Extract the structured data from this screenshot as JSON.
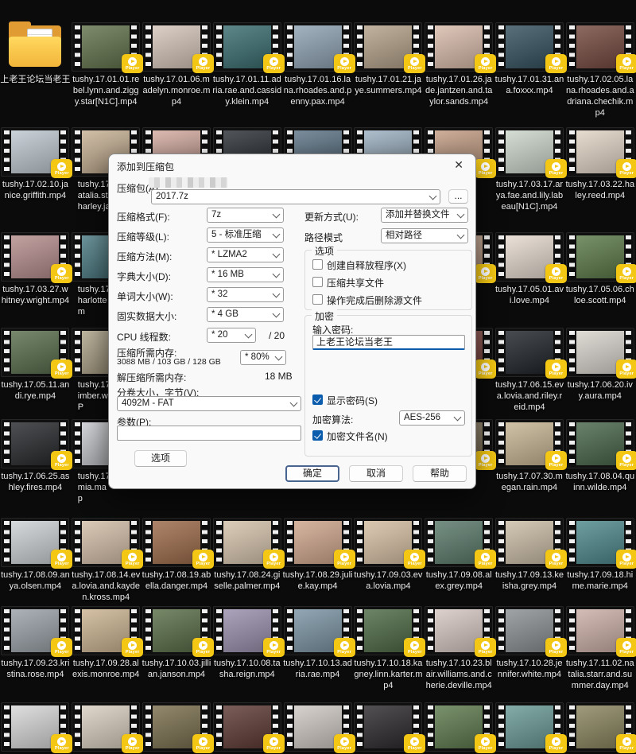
{
  "colors": {
    "accent_blue": "#0b5cad",
    "badge_yellow": "#f3c714",
    "folder_yellow": "#f2b43a"
  },
  "desktop": {
    "player_badge": "Player",
    "rows": [
      {
        "items": [
          {
            "kind": "folder",
            "label": "上老王论坛当老王"
          },
          {
            "kind": "video",
            "label": "tushy.17.01.01.rebel.lynn.and.ziggy.star[N1C].mp4",
            "color": "#62734c"
          },
          {
            "kind": "video",
            "label": "tushy.17.01.06.madelyn.monroe.mp4",
            "color": "#d6c6ba"
          },
          {
            "kind": "video",
            "label": "tushy.17.01.11.adria.rae.and.cassidy.klein.mp4",
            "color": "#3a6d70"
          },
          {
            "kind": "video",
            "label": "tushy.17.01.16.lana.rhoades.and.penny.pax.mp4",
            "color": "#8fa3b3"
          },
          {
            "kind": "video",
            "label": "tushy.17.01.21.jaye.summers.mp4",
            "color": "#b5a28a"
          },
          {
            "kind": "video",
            "label": "tushy.17.01.26.jade.jantzen.and.taylor.sands.mp4",
            "color": "#d9bcab"
          },
          {
            "kind": "video",
            "label": "tushy.17.01.31.ana.foxxx.mp4",
            "color": "#35525f"
          },
          {
            "kind": "video",
            "label": "tushy.17.02.05.lana.rhoades.and.adriana.chechik.mp4",
            "color": "#74493f"
          }
        ]
      },
      {
        "items": [
          {
            "kind": "video",
            "label": "tushy.17.02.10.janice.griffith.mp4",
            "color": "#bfc9d1"
          },
          {
            "kind": "video",
            "label": "tushy.17\natalia.st\nharley.ja",
            "color": "#c7b194",
            "pre": true
          },
          {
            "kind": "video",
            "label": "",
            "color": "#d4aba0"
          },
          {
            "kind": "video",
            "label": "",
            "color": "#2c3137"
          },
          {
            "kind": "video",
            "label": "",
            "color": "#5e7587"
          },
          {
            "kind": "video",
            "label": "",
            "color": "#9db1c2"
          },
          {
            "kind": "video",
            "label": "",
            "color": "#c49e85"
          },
          {
            "kind": "video",
            "label": "tushy.17.03.17.arya.fae.and.lily.labeau[N1C].mp4",
            "color": "#ccd6cc"
          },
          {
            "kind": "video",
            "label": "tushy.17.03.22.haley.reed.mp4",
            "color": "#e2d5c6"
          }
        ]
      },
      {
        "items": [
          {
            "kind": "video",
            "label": "tushy.17.03.27.whitney.wright.mp4",
            "color": "#b68d8d"
          },
          {
            "kind": "video",
            "label": "tushy.17\nharlotte\nm",
            "color": "#4d7e86",
            "pre": true
          },
          {
            "kind": "video",
            "label": "",
            "color": "#3a3a3a"
          },
          {
            "kind": "video",
            "label": "",
            "color": "#3a3a3a"
          },
          {
            "kind": "video",
            "label": "",
            "color": "#3a3a3a"
          },
          {
            "kind": "video",
            "label": "",
            "color": "#3a3a3a"
          },
          {
            "kind": "video",
            "label": "",
            "color": "#c9a78f"
          },
          {
            "kind": "video",
            "label": "tushy.17.05.01.avi.love.mp4",
            "color": "#e6dad0"
          },
          {
            "kind": "video",
            "label": "tushy.17.05.06.chloe.scott.mp4",
            "color": "#5c7a49"
          }
        ]
      },
      {
        "items": [
          {
            "kind": "video",
            "label": "tushy.17.05.11.andi.rye.mp4",
            "color": "#596e4d"
          },
          {
            "kind": "video",
            "label": "tushy.17\nimber.w\nP",
            "color": "#b2a78c",
            "pre": true
          },
          {
            "kind": "video",
            "label": "",
            "color": "#3a3a3a"
          },
          {
            "kind": "video",
            "label": "",
            "color": "#3a3a3a"
          },
          {
            "kind": "video",
            "label": "",
            "color": "#3a3a3a"
          },
          {
            "kind": "video",
            "label": "",
            "color": "#3a3a3a"
          },
          {
            "kind": "video",
            "label": "",
            "color": "#8a4a44"
          },
          {
            "kind": "video",
            "label": "tushy.17.06.15.eva.lovia.and.riley.reid.mp4",
            "color": "#20242a"
          },
          {
            "kind": "video",
            "label": "tushy.17.06.20.ivy.aura.mp4",
            "color": "#d9d4cd"
          }
        ]
      },
      {
        "items": [
          {
            "kind": "video",
            "label": "tushy.17.06.25.ashley.fires.mp4",
            "color": "#27292c"
          },
          {
            "kind": "video",
            "label": "tushy.17\nmia.ma\np",
            "color": "#cdced2",
            "pre": true
          },
          {
            "kind": "video",
            "label": "",
            "color": "#3a3a3a"
          },
          {
            "kind": "video",
            "label": "",
            "color": "#3a3a3a"
          },
          {
            "kind": "video",
            "label": "",
            "color": "#3a3a3a"
          },
          {
            "kind": "video",
            "label": "",
            "color": "#3a3a3a"
          },
          {
            "kind": "video",
            "label": "",
            "color": "#8a7a5e"
          },
          {
            "kind": "video",
            "label": "tushy.17.07.30.megan.rain.mp4",
            "color": "#c8b694"
          },
          {
            "kind": "video",
            "label": "tushy.17.08.04.quinn.wilde.mp4",
            "color": "#49664a"
          }
        ]
      },
      {
        "items": [
          {
            "kind": "video",
            "label": "tushy.17.08.09.anya.olsen.mp4",
            "color": "#ced2d5"
          },
          {
            "kind": "video",
            "label": "tushy.17.08.14.eva.lovia.and.kayden.kross.mp4",
            "color": "#d5bfa9"
          },
          {
            "kind": "video",
            "label": "tushy.17.08.19.abella.danger.mp4",
            "color": "#9e6c4b"
          },
          {
            "kind": "video",
            "label": "tushy.17.08.24.giselle.palmer.mp4",
            "color": "#d8c5ae"
          },
          {
            "kind": "video",
            "label": "tushy.17.08.29.julie.kay.mp4",
            "color": "#d1a88e"
          },
          {
            "kind": "video",
            "label": "tushy.17.09.03.eva.lovia.mp4",
            "color": "#d8c1a5"
          },
          {
            "kind": "video",
            "label": "tushy.17.09.08.alex.grey.mp4",
            "color": "#5b7a6b"
          },
          {
            "kind": "video",
            "label": "tushy.17.09.13.keisha.grey.mp4",
            "color": "#ccbea7"
          },
          {
            "kind": "video",
            "label": "tushy.17.09.18.hime.marie.mp4",
            "color": "#4f898d"
          }
        ]
      },
      {
        "items": [
          {
            "kind": "video",
            "label": "tushy.17.09.23.kristina.rose.mp4",
            "color": "#9ba2a9"
          },
          {
            "kind": "video",
            "label": "tushy.17.09.28.alexis.monroe.mp4",
            "color": "#ccb592"
          },
          {
            "kind": "video",
            "label": "tushy.17.10.03.jillian.janson.mp4",
            "color": "#5a6e48"
          },
          {
            "kind": "video",
            "label": "tushy.17.10.08.tasha.reign.mp4",
            "color": "#9a90ad"
          },
          {
            "kind": "video",
            "label": "tushy.17.10.13.adria.rae.mp4",
            "color": "#7b94a4"
          },
          {
            "kind": "video",
            "label": "tushy.17.10.18.kagney.linn.karter.mp4",
            "color": "#4e6a45"
          },
          {
            "kind": "video",
            "label": "tushy.17.10.23.blair.williams.and.cherie.deville.mp4",
            "color": "#d7c8c3"
          },
          {
            "kind": "video",
            "label": "tushy.17.10.28.jennifer.white.mp4",
            "color": "#8b9093"
          },
          {
            "kind": "video",
            "label": "tushy.17.11.02.natalia.starr.and.summer.day.mp4",
            "color": "#ccafa7"
          }
        ]
      },
      {
        "items": [
          {
            "kind": "video",
            "label": "",
            "color": "#d8d8d8"
          },
          {
            "kind": "video",
            "label": "",
            "color": "#d9cfc0"
          },
          {
            "kind": "video",
            "label": "",
            "color": "#7a6f4e"
          },
          {
            "kind": "video",
            "label": "",
            "color": "#5e3a34"
          },
          {
            "kind": "video",
            "label": "",
            "color": "#cfc9c4"
          },
          {
            "kind": "video",
            "label": "",
            "color": "#2e2a2e"
          },
          {
            "kind": "video",
            "label": "",
            "color": "#5e7a4e"
          },
          {
            "kind": "video",
            "label": "",
            "color": "#6a9a96"
          },
          {
            "kind": "video",
            "label": "",
            "color": "#8a855e"
          }
        ]
      }
    ]
  },
  "dialog": {
    "title": "添加到压缩包",
    "archive_label": "压缩包(A)",
    "archive_name": "2017.7z",
    "browse": "...",
    "fields_left": [
      {
        "label": "压缩格式(F):",
        "value": "7z"
      },
      {
        "label": "压缩等级(L):",
        "value": "5 - 标准压缩"
      },
      {
        "label": "压缩方法(M):",
        "value": "* LZMA2"
      },
      {
        "label": "字典大小(D):",
        "value": "* 16 MB"
      },
      {
        "label": "单词大小(W):",
        "value": "* 32"
      },
      {
        "label": "固实数据大小:",
        "value": "* 4 GB"
      }
    ],
    "cpu": {
      "label": "CPU 线程数:",
      "value": "* 20",
      "suffix": "/ 20"
    },
    "mem_compress": {
      "label": "压缩所需内存:",
      "detail": "3088 MB / 103 GB / 128 GB",
      "value": "* 80%"
    },
    "mem_decompress": {
      "label": "解压缩所需内存:",
      "value": "18 MB"
    },
    "volume": {
      "label": "分卷大小，字节(V):",
      "value": "4092M - FAT"
    },
    "params": {
      "label": "参数(P):",
      "value": ""
    },
    "options_button": "选项",
    "update_mode": {
      "label": "更新方式(U):",
      "value": "添加并替换文件"
    },
    "path_mode": {
      "label": "路径模式",
      "value": "相对路径"
    },
    "options_group": {
      "title": "选项",
      "checks": [
        {
          "label": "创建自释放程序(X)",
          "checked": false
        },
        {
          "label": "压缩共享文件",
          "checked": false
        },
        {
          "label": "操作完成后删除源文件",
          "checked": false
        }
      ]
    },
    "encrypt_group": {
      "title": "加密",
      "password_label": "输入密码:",
      "password": "上老王论坛当老王",
      "show_password": {
        "label": "显示密码(S)",
        "checked": true
      },
      "algo": {
        "label": "加密算法:",
        "value": "AES-256"
      },
      "encrypt_names": {
        "label": "加密文件名(N)",
        "checked": true
      }
    },
    "buttons": {
      "ok": "确定",
      "cancel": "取消",
      "help": "帮助"
    }
  }
}
